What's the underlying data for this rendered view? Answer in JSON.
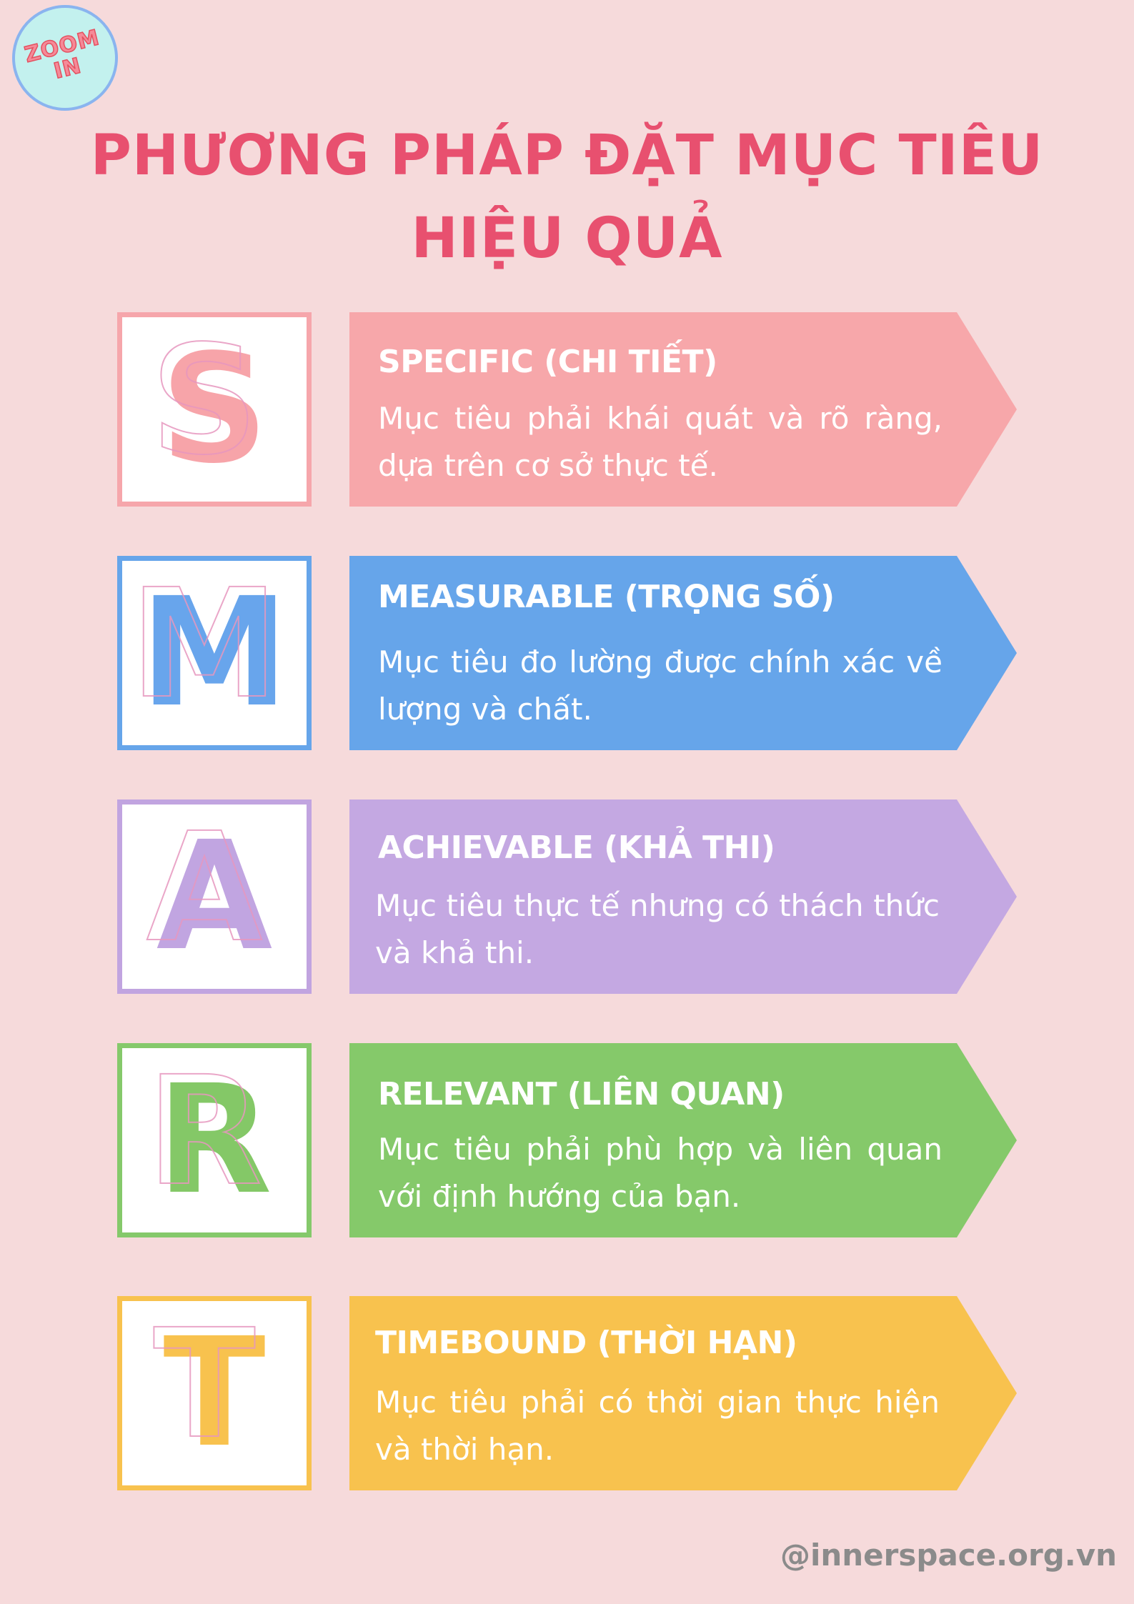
{
  "logo": {
    "line1": "ZOOM",
    "line2": "IN"
  },
  "title": {
    "line1": "PHƯƠNG PHÁP ĐẶT MỤC TIÊU",
    "line2": "HIỆU QUẢ"
  },
  "items": [
    {
      "letter": "S",
      "heading": "SPECIFIC (CHI TIẾT)",
      "body": "Mục tiêu phải khái quát và rõ ràng, dựa trên cơ sở thực tế.",
      "color": "#f7a7aa"
    },
    {
      "letter": "M",
      "heading": "MEASURABLE (TRỌNG SỐ)",
      "body": "Mục tiêu đo lường được chính xác về lượng và chất.",
      "color": "#66a5ea"
    },
    {
      "letter": "A",
      "heading": "ACHIEVABLE (KHẢ THI)",
      "body": "Mục tiêu thực tế nhưng có thách thức và khả thi.",
      "color": "#c4a8e2"
    },
    {
      "letter": "R",
      "heading": "RELEVANT (LIÊN QUAN)",
      "body": "Mục tiêu phải phù hợp và liên quan với định hướng của bạn.",
      "color": "#85c96a"
    },
    {
      "letter": "T",
      "heading": "TIMEBOUND (THỜI HẠN)",
      "body": "Mục tiêu phải có thời gian thực hiện và thời hạn.",
      "color": "#f8c24e"
    }
  ],
  "footer": {
    "handle": "@innerspace.org.vn"
  },
  "colors": {
    "background": "#f6dadb",
    "title": "#e8506f",
    "footer": "#8b8b8b"
  }
}
